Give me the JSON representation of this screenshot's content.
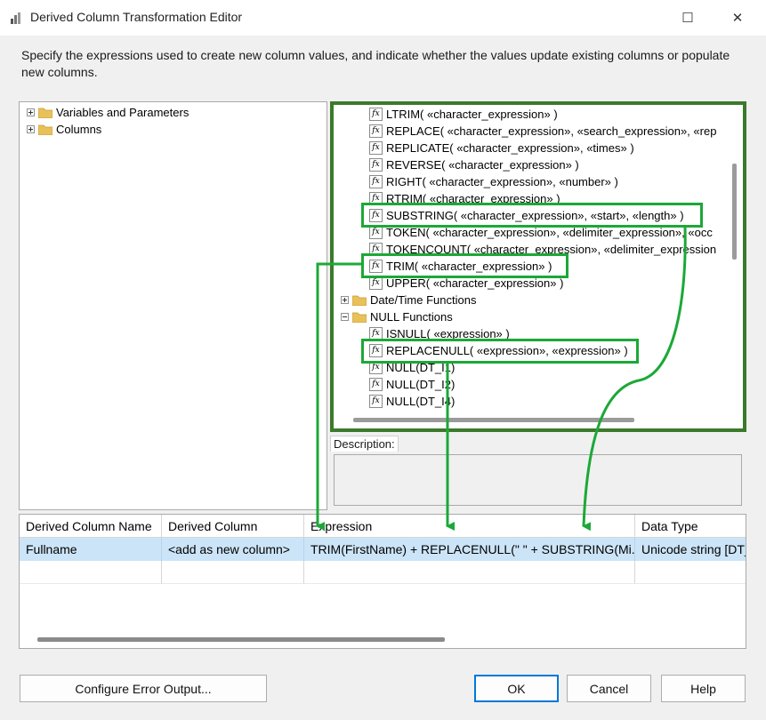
{
  "window": {
    "title": "Derived Column Transformation Editor",
    "maximize_icon": "☐",
    "close_icon": "✕"
  },
  "intro_text": "Specify the expressions used to create new column values, and indicate whether the values update existing columns or populate new columns.",
  "left_tree": [
    {
      "label": "Variables and Parameters"
    },
    {
      "label": "Columns"
    }
  ],
  "function_tree": {
    "string_functions": [
      "LTRIM( «character_expression» )",
      "REPLACE( «character_expression», «search_expression», «rep",
      "REPLICATE( «character_expression», «times» )",
      "REVERSE( «character_expression» )",
      "RIGHT( «character_expression», «number» )",
      "RTRIM( «character_expression» )",
      "SUBSTRING( «character_expression», «start», «length» )",
      "TOKEN( «character_expression», «delimiter_expression», «occ",
      "TOKENCOUNT( «character_expression», «delimiter_expression",
      "TRIM( «character_expression» )",
      "UPPER( «character_expression» )"
    ],
    "date_time_folder": "Date/Time Functions",
    "null_folder": "NULL Functions",
    "null_functions": [
      "ISNULL( «expression» )",
      "REPLACENULL( «expression», «expression» )",
      "NULL(DT_I1)",
      "NULL(DT_I2)",
      "NULL(DT_I4)"
    ],
    "fx_glyph": "fx"
  },
  "description": {
    "label": "Description:"
  },
  "grid": {
    "headers": [
      "Derived Column Name",
      "Derived Column",
      "Expression",
      "Data Type"
    ],
    "rows": [
      [
        "Fullname",
        "<add as new column>",
        "TRIM(FirstName) + REPLACENULL(\" \" + SUBSTRING(Mi...",
        "Unicode string [DT_WSTR]"
      ]
    ]
  },
  "buttons": {
    "configure_error_output": "Configure Error Output...",
    "ok": "OK",
    "cancel": "Cancel",
    "help": "Help"
  },
  "colors": {
    "highlight": "#1ca838",
    "panel_border": "#3b7a2b",
    "selection": "#cce4f7",
    "folder": "#e8c15a"
  }
}
